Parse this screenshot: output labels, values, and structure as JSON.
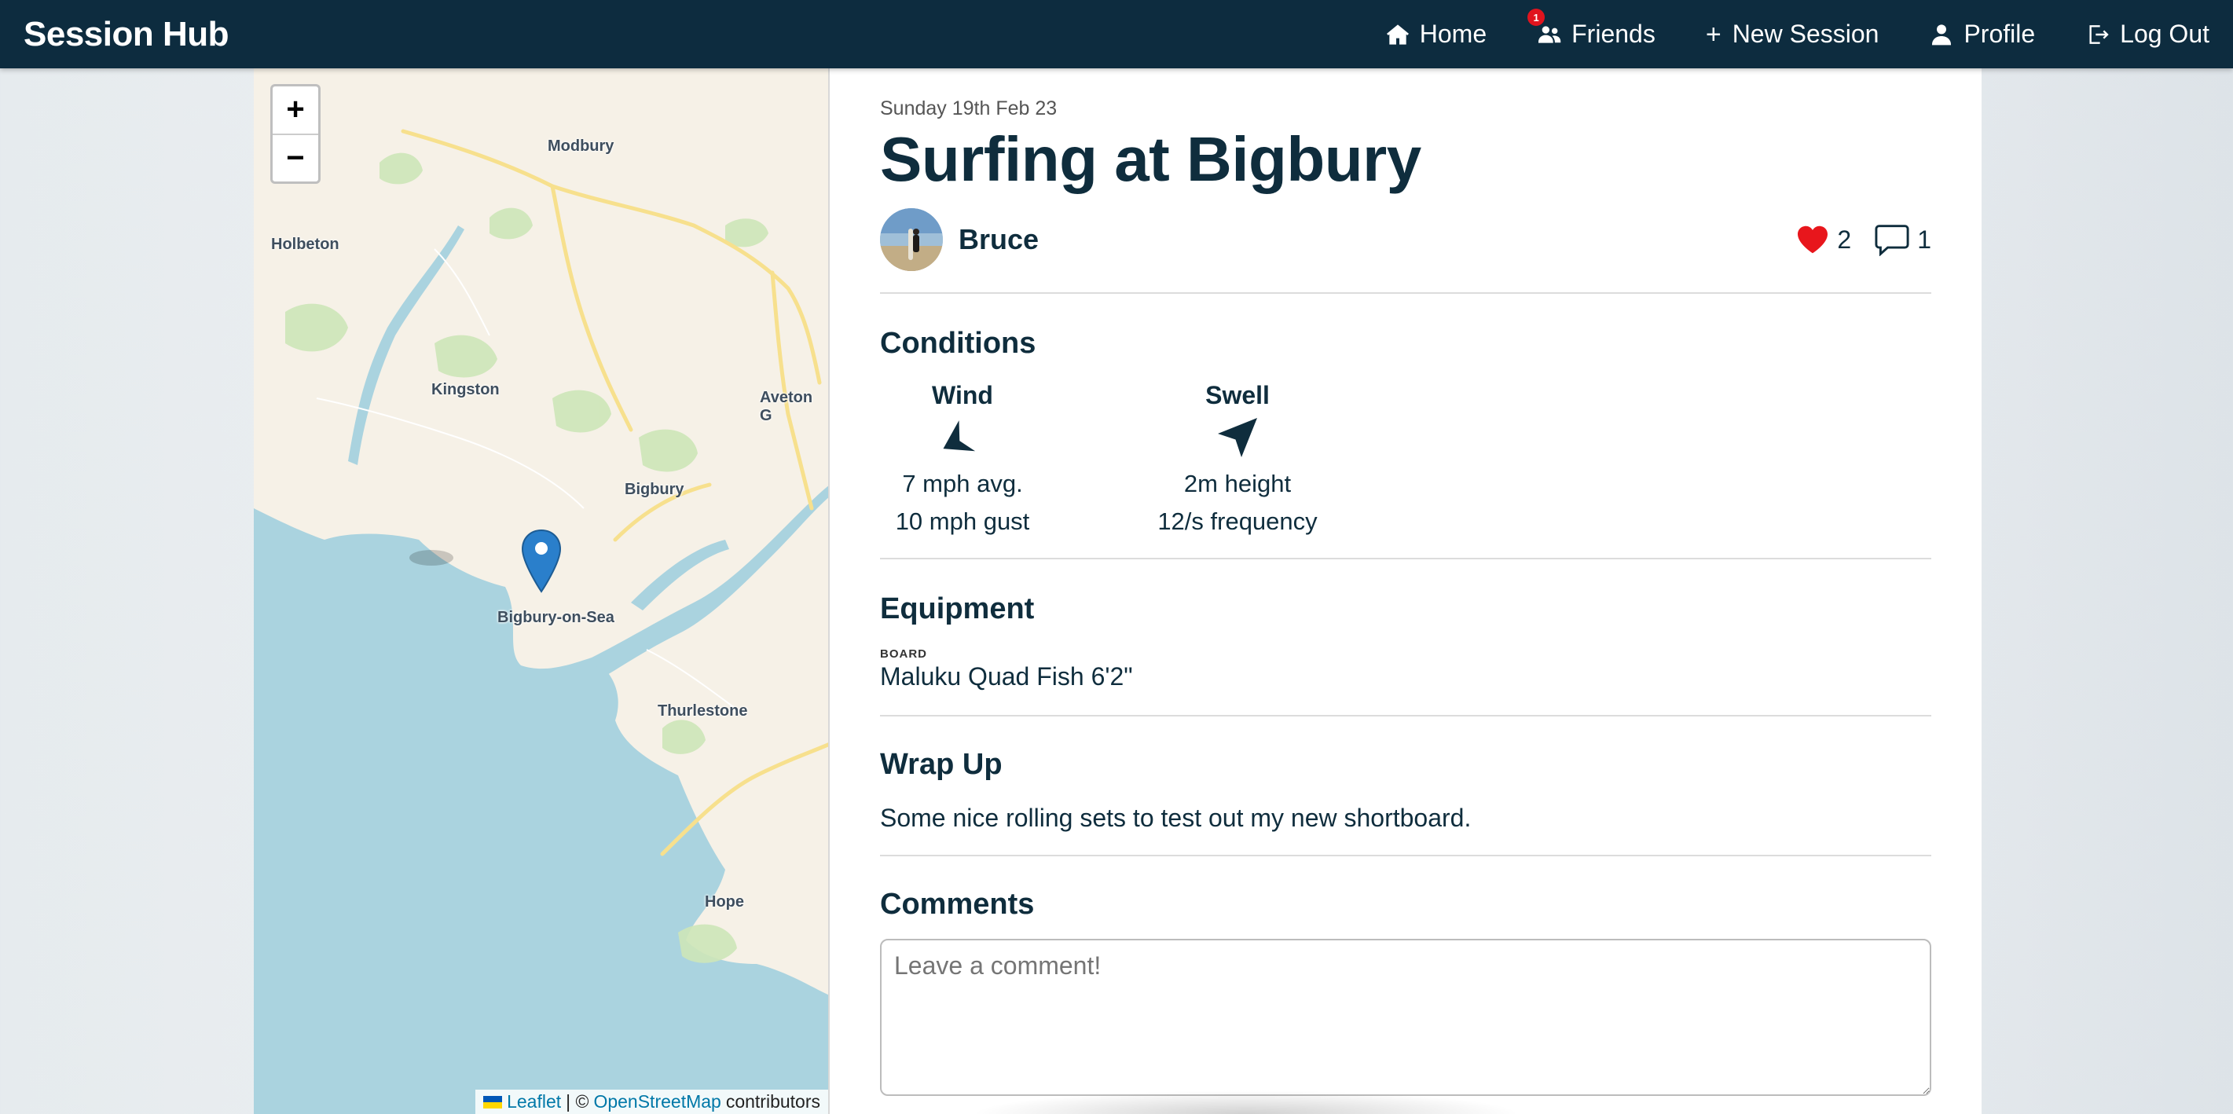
{
  "app": {
    "brand": "Session Hub"
  },
  "nav": {
    "home": "Home",
    "friends": "Friends",
    "friends_badge": "1",
    "new_session": "New Session",
    "profile": "Profile",
    "logout": "Log Out"
  },
  "map": {
    "zoom_in": "+",
    "zoom_out": "−",
    "places": [
      "Modbury",
      "Holbeton",
      "Kingston",
      "Aveton G",
      "Bigbury",
      "Bigbury-on-Sea",
      "Thurlestone",
      "Hope"
    ],
    "attribution": {
      "leaflet": "Leaflet",
      "separator": "| ©",
      "osm": "OpenStreetMap",
      "contributors": "contributors"
    }
  },
  "session": {
    "date": "Sunday 19th Feb 23",
    "title": "Surfing at Bigbury",
    "user": "Bruce",
    "likes": "2",
    "comments_count": "1"
  },
  "conditions": {
    "title": "Conditions",
    "wind": {
      "label": "Wind",
      "avg": "7 mph avg.",
      "gust": "10 mph gust",
      "icon": "wind-arrow-icon"
    },
    "swell": {
      "label": "Swell",
      "height": "2m height",
      "frequency": "12/s frequency",
      "icon": "swell-arrow-icon"
    }
  },
  "equipment": {
    "title": "Equipment",
    "board_label": "BOARD",
    "board": "Maluku Quad Fish 6'2\""
  },
  "wrapup": {
    "title": "Wrap Up",
    "text": "Some nice rolling sets to test out my new shortboard."
  },
  "comments": {
    "title": "Comments",
    "placeholder": "Leave a comment!"
  },
  "colors": {
    "navbar": "#0d2c3f",
    "heart": "#e8161c",
    "marker": "#2a7fcb",
    "sea": "#aad3df"
  }
}
